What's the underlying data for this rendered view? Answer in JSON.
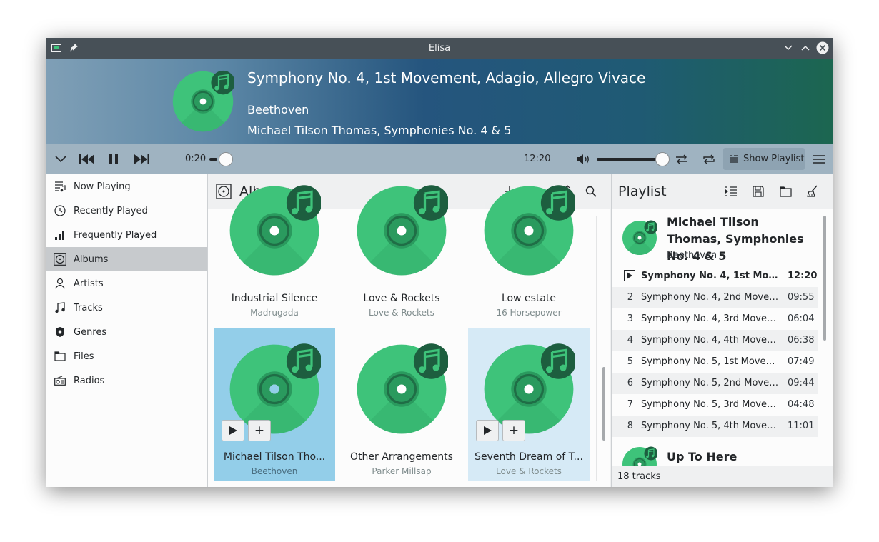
{
  "window": {
    "title": "Elisa"
  },
  "now_playing": {
    "title": "Symphony No. 4, 1st Movement, Adagio, Allegro Vivace",
    "artist": "Beethoven",
    "album": "Michael Tilson Thomas, Symphonies No. 4 & 5"
  },
  "controls": {
    "elapsed": "0:20",
    "total": "12:20",
    "progress_fraction": 0.027,
    "volume_fraction": 0.95,
    "show_playlist_label": "Show Playlist"
  },
  "sidebar": {
    "items": [
      {
        "label": "Now Playing",
        "icon": "now-playing-icon"
      },
      {
        "label": "Recently Played",
        "icon": "clock-icon"
      },
      {
        "label": "Frequently Played",
        "icon": "bar-chart-icon"
      },
      {
        "label": "Albums",
        "icon": "album-icon",
        "active": true
      },
      {
        "label": "Artists",
        "icon": "person-icon"
      },
      {
        "label": "Tracks",
        "icon": "music-note-icon"
      },
      {
        "label": "Genres",
        "icon": "shield-icon"
      },
      {
        "label": "Files",
        "icon": "folder-icon"
      },
      {
        "label": "Radios",
        "icon": "radio-icon"
      }
    ]
  },
  "albums_view": {
    "title": "Albums",
    "albums": [
      {
        "name": "Industrial Silence",
        "artist": "Madrugada"
      },
      {
        "name": "Love & Rockets",
        "artist": "Love & Rockets"
      },
      {
        "name": "Low estate",
        "artist": "16 Horsepower"
      },
      {
        "name": "Michael Tilson Tho...",
        "artist": "Beethoven",
        "state": "selected"
      },
      {
        "name": "Other Arrangements",
        "artist": "Parker Millsap"
      },
      {
        "name": "Seventh Dream of T...",
        "artist": "Love & Rockets",
        "state": "hover"
      }
    ]
  },
  "playlist": {
    "title": "Playlist",
    "album_header": {
      "name": "Michael Tilson Thomas, Symphonies No. 4 & 5",
      "artist": "Beethoven"
    },
    "tracks": [
      {
        "num": "",
        "title": "Symphony No. 4, 1st Moveme...",
        "duration": "12:20",
        "playing": true
      },
      {
        "num": "2",
        "title": "Symphony No. 4, 2nd Movem...",
        "duration": "09:55"
      },
      {
        "num": "3",
        "title": "Symphony No. 4, 3rd Movem...",
        "duration": "06:04"
      },
      {
        "num": "4",
        "title": "Symphony No. 4, 4th Movem...",
        "duration": "06:38"
      },
      {
        "num": "5",
        "title": "Symphony No. 5, 1st Moveme...",
        "duration": "07:49"
      },
      {
        "num": "6",
        "title": "Symphony No. 5, 2nd Movem...",
        "duration": "09:44"
      },
      {
        "num": "7",
        "title": "Symphony No. 5, 3rd Movem...",
        "duration": "04:48"
      },
      {
        "num": "8",
        "title": "Symphony No. 5, 4th Movem...",
        "duration": "11:01"
      }
    ],
    "next_album": "Up To Here",
    "footer": "18 tracks"
  },
  "colors": {
    "accent_green": "#3ec37a",
    "selection_blue": "#93cee9",
    "hover_blue": "#d6eaf6"
  }
}
